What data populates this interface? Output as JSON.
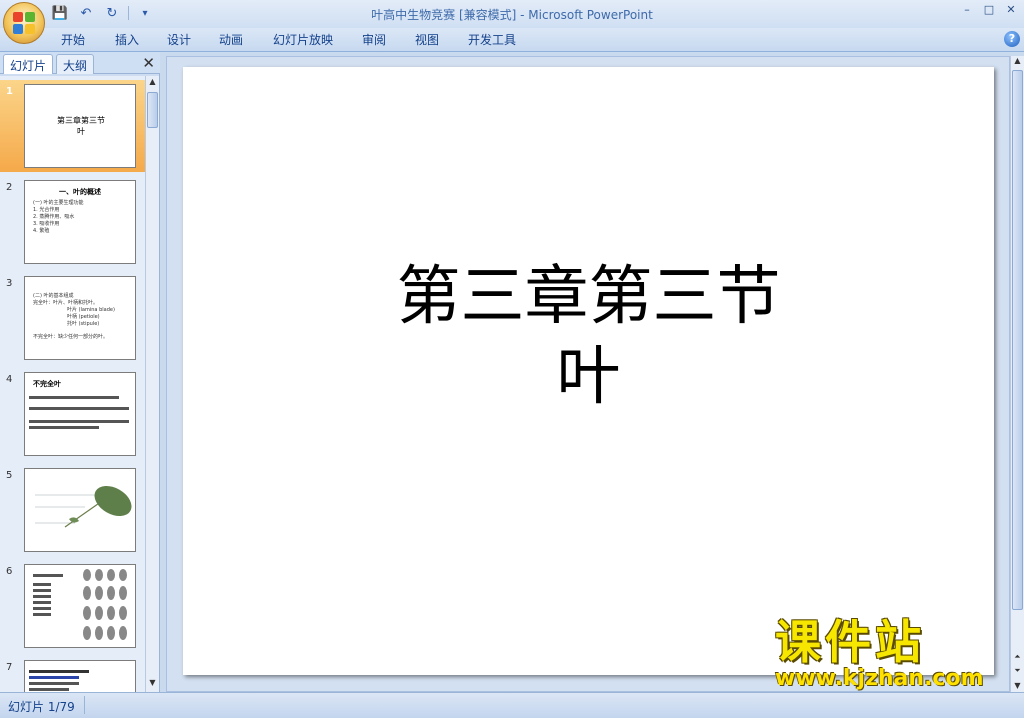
{
  "window": {
    "title": "叶高中生物竞赛 [兼容模式] - Microsoft PowerPoint",
    "controls": [
      "–",
      "□",
      "✕"
    ]
  },
  "qat": {
    "save": "💾",
    "undo": "↶",
    "redo": "↻",
    "more": "▾"
  },
  "ribbon": {
    "tabs": [
      "开始",
      "插入",
      "设计",
      "动画",
      "幻灯片放映",
      "审阅",
      "视图",
      "开发工具"
    ],
    "help": "?"
  },
  "pane": {
    "tabs": [
      "幻灯片",
      "大纲"
    ],
    "close": "✕",
    "slides": [
      {
        "num": "1",
        "title": "第三章第三节\n叶"
      },
      {
        "num": "2",
        "heading": "一、叶的概述",
        "lines": [
          "(一) 叶的主要生理功能",
          "1. 光合作用",
          "2. 蒸腾作用、吸水",
          "3. 吸收作用",
          "4. 繁殖"
        ]
      },
      {
        "num": "3",
        "lines": [
          "(二) 叶的基本组成",
          "完全叶：叶片、叶柄和托叶。",
          "叶片 (lamina blade)",
          "叶柄 (petiole)",
          "托叶 (stipule)",
          "不完全叶：缺少任何一部分的叶。"
        ]
      },
      {
        "num": "4",
        "heading": "不完全叶"
      },
      {
        "num": "5"
      },
      {
        "num": "6"
      },
      {
        "num": "7"
      }
    ]
  },
  "slide": {
    "title_line1": "第三章第三节",
    "title_line2": "叶"
  },
  "status": {
    "slide_counter": "幻灯片 1/79"
  },
  "watermark": {
    "main": "课件站",
    "url": "www.kjzhan.com"
  },
  "colors": {
    "selection": "#f5a94a",
    "ribbon": "#15428b",
    "watermark": "#f6e600"
  }
}
